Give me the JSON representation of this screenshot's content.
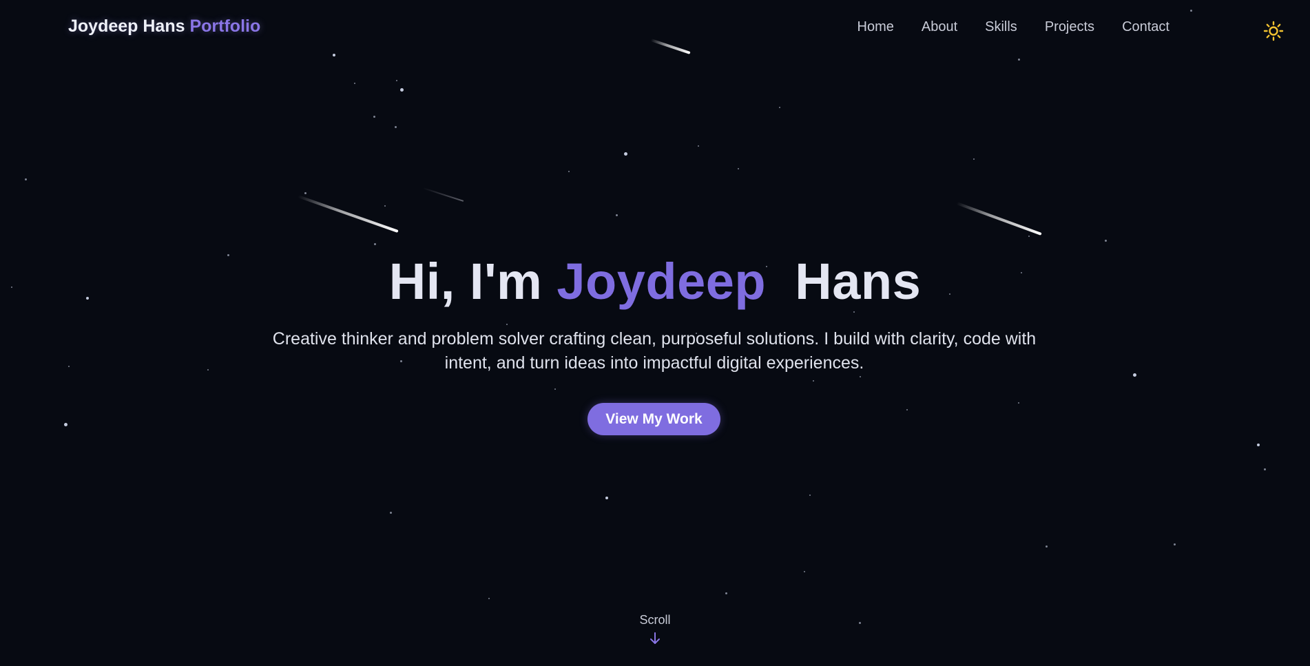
{
  "nav": {
    "brand_name": "Joydeep Hans",
    "brand_accent": "Portfolio",
    "links": [
      "Home",
      "About",
      "Skills",
      "Projects",
      "Contact"
    ],
    "theme_icon": "sun-icon"
  },
  "hero": {
    "greeting": "Hi, I'm",
    "first_name": "Joydeep",
    "last_name": "Hans",
    "subtitle_line1": "Creative thinker and problem solver crafting clean, purposeful solutions. I build with clarity, code with",
    "subtitle_line2": "intent, and turn ideas into impactful digital experiences.",
    "cta_label": "View My Work",
    "scroll_label": "Scroll",
    "scroll_icon": "arrow-down-icon"
  },
  "colors": {
    "background": "#070a12",
    "accent": "#7f6de0",
    "sun": "#f2c230"
  }
}
